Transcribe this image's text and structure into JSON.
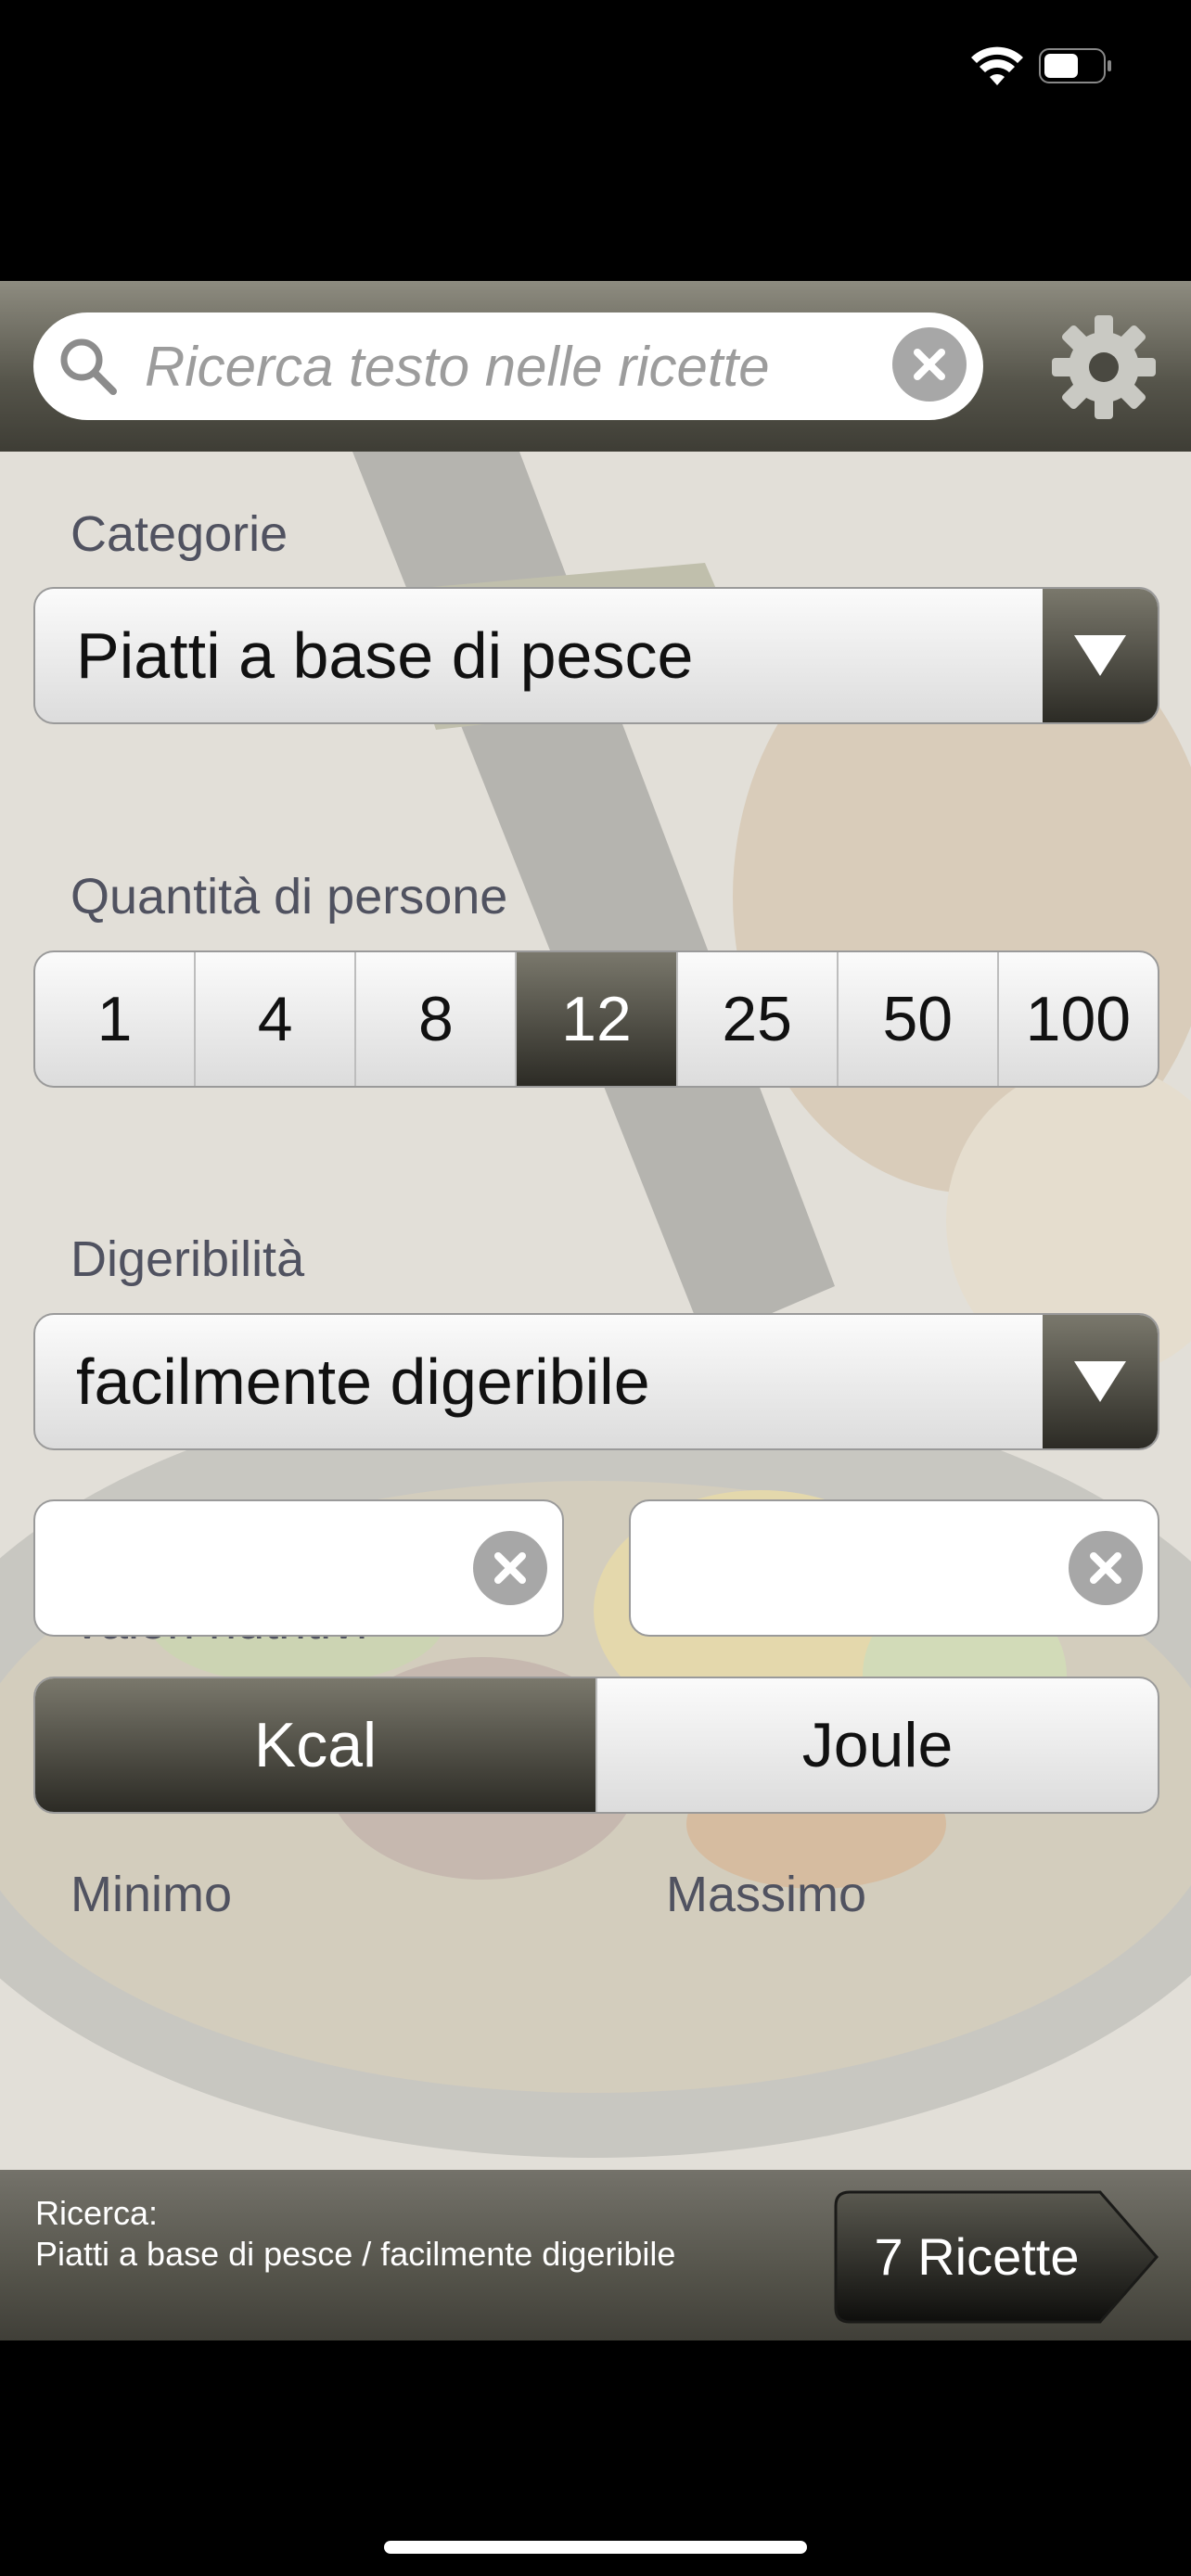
{
  "search": {
    "placeholder": "Ricerca testo nelle ricette",
    "value": ""
  },
  "filters": {
    "category": {
      "label": "Categorie",
      "value": "Piatti a base di pesce"
    },
    "servings": {
      "label": "Quantità di persone",
      "options": [
        "1",
        "4",
        "8",
        "12",
        "25",
        "50",
        "100"
      ],
      "selected": "12"
    },
    "digestibility": {
      "label": "Digeribilità",
      "value": "facilmente digeribile"
    },
    "nutrition": {
      "label": "Valori nutritivi",
      "options": [
        "Kcal",
        "Joule"
      ],
      "selected": "Kcal"
    },
    "min": {
      "label": "Minimo",
      "value": ""
    },
    "max": {
      "label": "Massimo",
      "value": ""
    }
  },
  "summary": {
    "title": "Ricerca:",
    "text": "Piatti a base di pesce / facilmente digeribile"
  },
  "result_button": {
    "label": "7 Ricette"
  },
  "icons": {
    "wifi": "wifi-icon",
    "battery": "battery-icon",
    "search": "search-icon",
    "clear": "clear-icon",
    "settings": "gear-icon",
    "dropdown": "triangle-down-icon"
  },
  "colors": {
    "bar_dark": "#3e3d35",
    "accent_active": "#2c2b25",
    "label_text": "#505260"
  }
}
